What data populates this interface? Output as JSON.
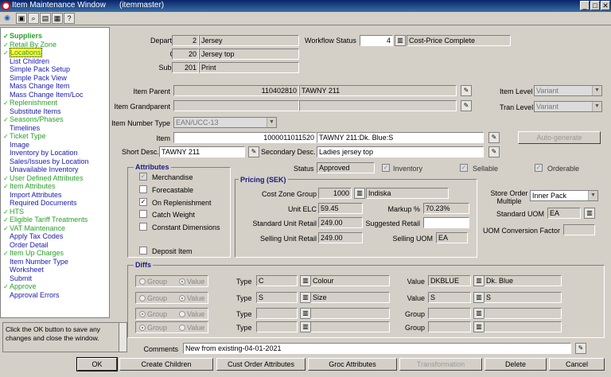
{
  "window": {
    "title": "Item Maintenance Window",
    "form": "(itemmaster)"
  },
  "menu": [
    {
      "label": "Suppliers",
      "style": "hdr",
      "check": true
    },
    {
      "label": "Retail By Zone",
      "style": "green",
      "check": true
    },
    {
      "label": "Locations",
      "style": "green sel",
      "check": true
    },
    {
      "label": "List Children",
      "style": "blue",
      "check": false
    },
    {
      "label": "Simple Pack Setup",
      "style": "blue",
      "check": false
    },
    {
      "label": "Simple Pack View",
      "style": "blue",
      "check": false
    },
    {
      "label": "Mass Change Item",
      "style": "blue",
      "check": false
    },
    {
      "label": "Mass Change Item/Loc",
      "style": "blue",
      "check": false
    },
    {
      "label": "Replenishment",
      "style": "green",
      "check": true
    },
    {
      "label": "Substitute Items",
      "style": "blue",
      "check": false
    },
    {
      "label": "Seasons/Phases",
      "style": "green",
      "check": true
    },
    {
      "label": "Timelines",
      "style": "blue",
      "check": false
    },
    {
      "label": "Ticket Type",
      "style": "green",
      "check": true
    },
    {
      "label": "Image",
      "style": "blue",
      "check": false
    },
    {
      "label": "Inventory by Location",
      "style": "blue",
      "check": false
    },
    {
      "label": "Sales/Issues by Location",
      "style": "blue",
      "check": false
    },
    {
      "label": "Unavailable Inventory",
      "style": "blue",
      "check": false
    },
    {
      "label": "User Defined Attributes",
      "style": "green",
      "check": true
    },
    {
      "label": "Item Attributes",
      "style": "green",
      "check": true
    },
    {
      "label": "Import Attributes",
      "style": "blue",
      "check": false
    },
    {
      "label": "Required Documents",
      "style": "blue",
      "check": false
    },
    {
      "label": "HTS",
      "style": "green",
      "check": true
    },
    {
      "label": "Eligible Tariff Treatments",
      "style": "green",
      "check": true
    },
    {
      "label": "VAT Maintenance",
      "style": "green",
      "check": true
    },
    {
      "label": "Apply Tax Codes",
      "style": "blue",
      "check": false
    },
    {
      "label": "Order Detail",
      "style": "blue",
      "check": false
    },
    {
      "label": "Item Up Charges",
      "style": "green",
      "check": true
    },
    {
      "label": "Item Number Type",
      "style": "blue",
      "check": false
    },
    {
      "label": "Worksheet",
      "style": "blue",
      "check": false
    },
    {
      "label": "Submit",
      "style": "blue",
      "check": false
    },
    {
      "label": "Approve",
      "style": "green",
      "check": true
    },
    {
      "label": "Approval Errors",
      "style": "blue",
      "check": false
    }
  ],
  "help": "Click the OK button to save any changes and close the window.",
  "header": {
    "department_label": "Department",
    "department_code": "2",
    "department_name": "Jersey",
    "class_label": "Class",
    "class_code": "20",
    "class_name": "Jersey top",
    "subclass_label": "Subclass",
    "subclass_code": "201",
    "subclass_name": "Print",
    "workflow_label": "Workflow Status",
    "workflow_code": "4",
    "workflow_name": "Cost-Price Complete"
  },
  "item": {
    "parent_label": "Item Parent",
    "parent_code": "110402810",
    "parent_desc": "TAWNY 211",
    "grandparent_label": "Item Grandparent",
    "level_label": "Item Level",
    "level_value": "Variant",
    "tran_level_label": "Tran Level",
    "tran_level_value": "Variant",
    "number_type_label": "Item Number Type",
    "number_type_value": "EAN/UCC-13",
    "item_label": "Item",
    "item_code": "1000011011520",
    "item_desc": "TAWNY 211:Dk. Blue:S",
    "auto_generate": "Auto-generate",
    "short_desc_label": "Short Desc.",
    "short_desc": "TAWNY 211",
    "secondary_desc_label": "Secondary Desc.",
    "secondary_desc": "Ladies jersey top",
    "status_label": "Status",
    "status_value": "Approved",
    "inventory_label": "Inventory",
    "sellable_label": "Sellable",
    "orderable_label": "Orderable"
  },
  "attributes": {
    "title": "Attributes",
    "items": [
      {
        "label": "Merchandise",
        "checked": true,
        "disabled": true
      },
      {
        "label": "Forecastable",
        "checked": false,
        "disabled": false
      },
      {
        "label": "On Replenishment",
        "checked": true,
        "disabled": false
      },
      {
        "label": "Catch Weight",
        "checked": false,
        "disabled": false
      },
      {
        "label": "Constant Dimensions",
        "checked": false,
        "disabled": false
      },
      {
        "label": "Deposit Item",
        "checked": false,
        "disabled": false
      }
    ]
  },
  "pricing": {
    "title": "Pricing (SEK)",
    "cost_zone_label": "Cost Zone Group",
    "cost_zone_code": "1000",
    "cost_zone_name": "Indiska",
    "unit_elc_label": "Unit ELC",
    "unit_elc": "59.45",
    "markup_label": "Markup %",
    "markup": "70.23%",
    "std_retail_label": "Standard Unit Retail",
    "std_retail": "249.00",
    "suggested_label": "Suggested Retail",
    "suggested": "",
    "selling_retail_label": "Selling Unit Retail",
    "selling_retail": "249.00",
    "selling_uom_label": "Selling UOM",
    "selling_uom": "EA"
  },
  "store": {
    "order_multiple_label": "Store Order Multiple",
    "order_multiple_value": "Inner Pack",
    "std_uom_label": "Standard UOM",
    "std_uom": "EA",
    "uom_conv_label": "UOM Conversion Factor",
    "uom_conv": ""
  },
  "diffs": {
    "title": "Diffs",
    "group_label": "Group",
    "value_label": "Value",
    "type_label": "Type",
    "rows": [
      {
        "type_code": "C",
        "type_name": "Colour",
        "right_label": "Value",
        "right_code": "DKBLUE",
        "right_name": "Dk. Blue"
      },
      {
        "type_code": "S",
        "type_name": "Size",
        "right_label": "Value",
        "right_code": "S",
        "right_name": "S"
      },
      {
        "type_code": "",
        "type_name": "",
        "right_label": "Group",
        "right_code": "",
        "right_name": ""
      },
      {
        "type_code": "",
        "type_name": "",
        "right_label": "Group",
        "right_code": "",
        "right_name": ""
      }
    ]
  },
  "comments": {
    "label": "Comments",
    "value": "New from existing-04-01-2021"
  },
  "buttons": [
    "OK",
    "Create Children",
    "Cust Order Attributes",
    "Groc Attributes",
    "Transformation",
    "Delete",
    "Cancel"
  ]
}
